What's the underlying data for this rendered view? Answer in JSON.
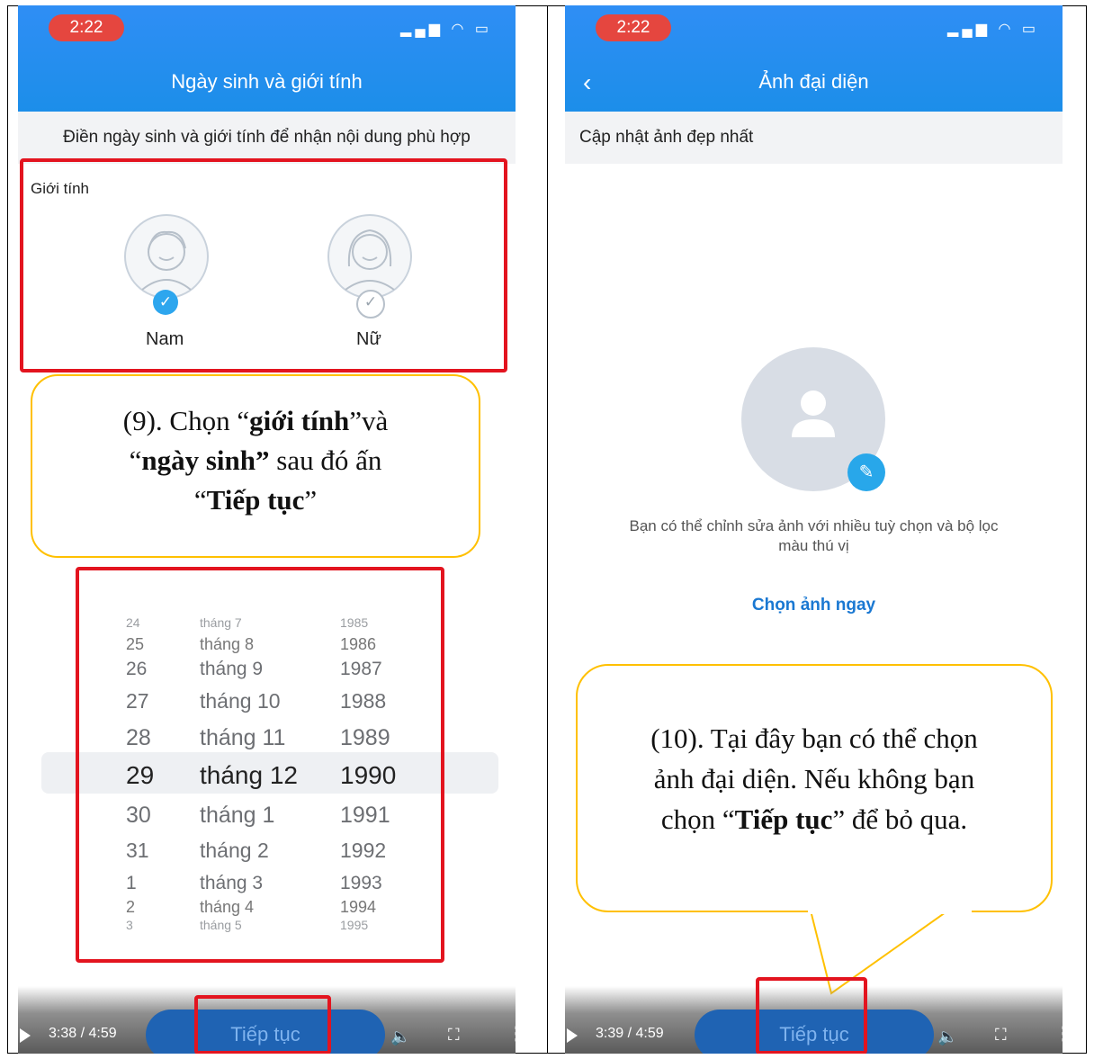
{
  "left": {
    "status_time": "2:22",
    "title": "Ngày sinh và giới tính",
    "subtitle": "Điền ngày sinh và giới tính để nhận nội dung phù hợp",
    "gender_label": "Giới tính",
    "gender_male": "Nam",
    "gender_female": "Nữ",
    "callout": {
      "prefix": "(9). Chọn “",
      "b1": "giới tính",
      "mid1": "”và",
      "q1": "“",
      "b2": "ngày sinh”",
      "mid2": " sau đó ấn",
      "q2": "“",
      "b3": "Tiếp tục",
      "q3": "”"
    },
    "picker_rows": [
      {
        "day": "24",
        "month": "tháng 7",
        "year": "1985"
      },
      {
        "day": "25",
        "month": "tháng 8",
        "year": "1986"
      },
      {
        "day": "26",
        "month": "tháng 9",
        "year": "1987"
      },
      {
        "day": "27",
        "month": "tháng 10",
        "year": "1988"
      },
      {
        "day": "28",
        "month": "tháng 11",
        "year": "1989"
      },
      {
        "day": "29",
        "month": "tháng 12",
        "year": "1990"
      },
      {
        "day": "30",
        "month": "tháng 1",
        "year": "1991"
      },
      {
        "day": "31",
        "month": "tháng 2",
        "year": "1992"
      },
      {
        "day": "1",
        "month": "tháng 3",
        "year": "1993"
      },
      {
        "day": "2",
        "month": "tháng 4",
        "year": "1994"
      },
      {
        "day": "3",
        "month": "tháng 5",
        "year": "1995"
      }
    ],
    "video_time": "3:38 / 4:59",
    "continue_label": "Tiếp tục"
  },
  "right": {
    "status_time": "2:22",
    "title": "Ảnh đại diện",
    "subtitle": "Cập nhật ảnh đẹp nhất",
    "desc_line1": "Bạn có thể chỉnh sửa ảnh với nhiều tuỳ chọn và bộ lọc",
    "desc_line2": "màu thú vị",
    "choose_link": "Chọn ảnh ngay",
    "callout": {
      "line1": "(10). Tại đây bạn có thể chọn",
      "line2": "ảnh đại diện. Nếu không bạn",
      "line3_a": "chọn “",
      "line3_b": "Tiếp tục",
      "line3_c": "” để bỏ qua."
    },
    "video_time": "3:39 / 4:59",
    "continue_label": "Tiếp tục"
  },
  "colors": {
    "header_blue": "#1c8ee9",
    "highlight_red": "#e3141f",
    "callout_border": "#ffc000",
    "button_blue": "#1f63b3"
  },
  "icons": [
    "back-arrow-icon",
    "signal-icon",
    "wifi-icon",
    "battery-icon",
    "check-icon",
    "user-icon",
    "pencil-icon",
    "play-icon",
    "volume-icon",
    "fullscreen-icon",
    "more-icon"
  ]
}
